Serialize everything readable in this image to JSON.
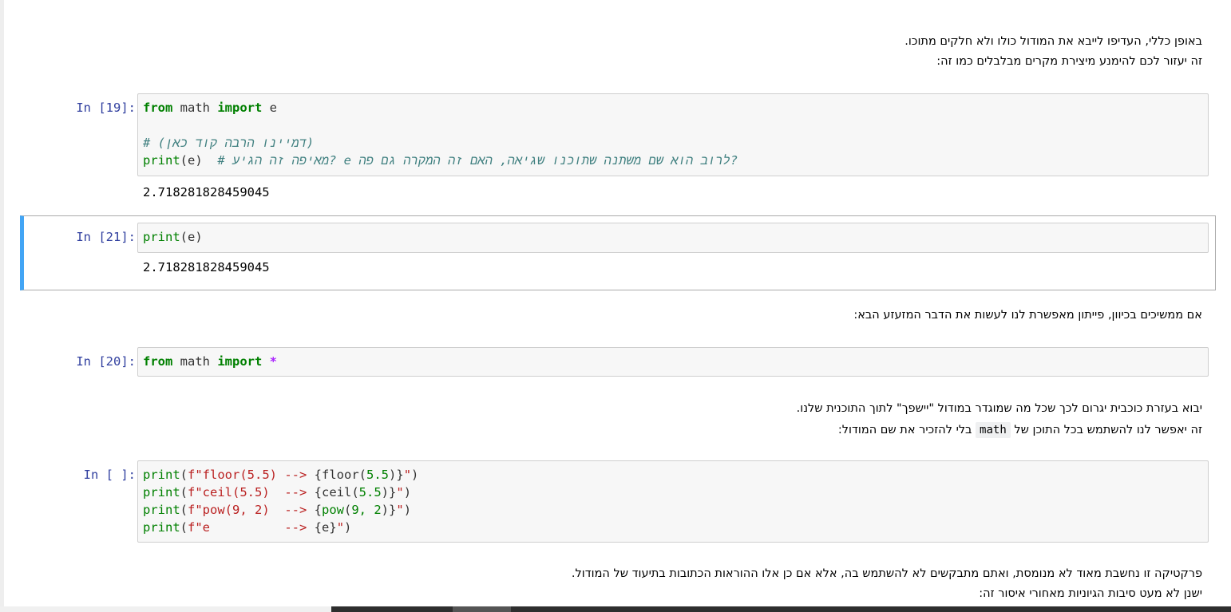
{
  "markdown_1": {
    "line1": "באופן כללי, העדיפו לייבא את המודול כולו ולא חלקים מתוכו.",
    "line2": "זה יעזור לכם להימנע מיצירת מקרים מבלבלים כמו זה:"
  },
  "cell_19": {
    "prompt": "In [19]:",
    "line1": {
      "kw1": "from",
      "mod": " math ",
      "kw2": "import",
      "name": " e"
    },
    "line3": {
      "comment": "# (דמיינו הרבה קוד כאן)"
    },
    "line4": {
      "fn": "print",
      "args": "(e)  ",
      "comment": "# מאיפה זה הגיע? e לרוב הוא שם משתנה שתוכנו שגיאה, האם זה המקרה גם פה?"
    },
    "output": "2.718281828459045"
  },
  "cell_21": {
    "prompt": "In [21]:",
    "line1": {
      "fn": "print",
      "args": "(e)"
    },
    "output": "2.718281828459045"
  },
  "markdown_2": {
    "line1": "אם ממשיכים בכיוון, פייתון מאפשרת לנו לעשות את הדבר המזעזע הבא:"
  },
  "cell_20": {
    "prompt": "In [20]:",
    "line1": {
      "kw1": "from",
      "mod": " math ",
      "kw2": "import",
      "op": "*"
    }
  },
  "markdown_3": {
    "line1": "יבוא בעזרת כוכבית יגרום לכך שכל מה שמוגדר במודול \"יישפך\" לתוך התוכנית שלנו.",
    "line2_before": "זה יאפשר לנו להשתמש בכל התוכן של",
    "line2_code": "math",
    "line2_after": "בלי להזכיר את שם המודול:"
  },
  "cell_new": {
    "prompt": "In [ ]:",
    "lines": [
      {
        "fn": "print",
        "p1": "(",
        "str1": "f\"floor(5.5) --> ",
        "brace_open": "{",
        "call": "floor",
        "call_open": "(",
        "num": "5.5",
        "call_close": ")",
        "brace_close": "}",
        "str2": "\"",
        "p2": ")"
      },
      {
        "fn": "print",
        "p1": "(",
        "str1": "f\"ceil(5.5)  --> ",
        "brace_open": "{",
        "call": "ceil",
        "call_open": "(",
        "num": "5.5",
        "call_close": ")",
        "brace_close": "}",
        "str2": "\"",
        "p2": ")"
      },
      {
        "fn": "print",
        "p1": "(",
        "str1": "f\"pow(9, 2)  --> ",
        "brace_open": "{",
        "call": "pow",
        "call_open": "(",
        "num": "9, 2",
        "call_close": ")",
        "brace_close": "}",
        "str2": "\"",
        "p2": ")"
      },
      {
        "fn": "print",
        "p1": "(",
        "str1": "f\"e          --> ",
        "brace_open": "{",
        "call": "e",
        "call_open": "",
        "num": "",
        "call_close": "",
        "brace_close": "}",
        "str2": "\"",
        "p2": ")"
      }
    ]
  },
  "markdown_4": {
    "line1": "פרקטיקה זו נחשבת מאוד לא מנומסת, ואתם מתבקשים לא להשתמש בה, אלא אם כן אלו ההוראות הכתובות בתיעוד של המודול.",
    "line2": "ישנן לא מעט סיבות הגיוניות מאחורי איסור זה:"
  }
}
